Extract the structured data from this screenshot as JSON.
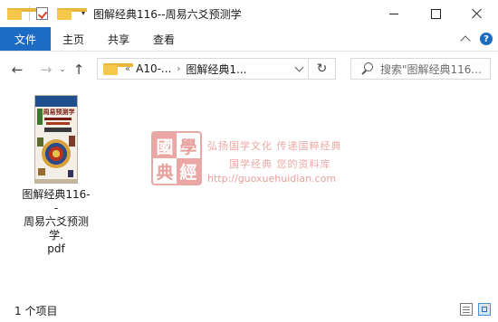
{
  "window": {
    "title": "图解经典116--周易六爻预测学"
  },
  "quick_access": {
    "icons": [
      "folder-icon",
      "properties-check-icon",
      "new-folder-icon",
      "customize-dropdown-icon"
    ]
  },
  "ribbon": {
    "tabs": [
      {
        "label": "文件",
        "active": true
      },
      {
        "label": "主页"
      },
      {
        "label": "共享"
      },
      {
        "label": "查看"
      }
    ],
    "help_label": "?"
  },
  "navigation": {
    "back_icon": "←",
    "forward_icon": "→",
    "recent_icon": "⌄",
    "up_icon": "↑",
    "refresh_icon": "↻"
  },
  "address": {
    "overflow": "«",
    "crumbs": [
      "A10-...",
      "图解经典1..."
    ],
    "separator": "›"
  },
  "search": {
    "placeholder": "搜索\"图解经典116..."
  },
  "files": [
    {
      "name": "图解经典116--周易六爻预测学.pdf",
      "name_lines": [
        "图解经典116--",
        "周易六爻预测学.",
        "pdf"
      ],
      "thumb_title": "周易预测学"
    }
  ],
  "watermark": {
    "seal_chars": [
      "國",
      "學",
      "典",
      "經"
    ],
    "line1": "弘扬国学文化  传递国粹经典",
    "line2": "国学经典  您的资料库",
    "url": "http://guoxuehuidian.com"
  },
  "status": {
    "item_count": "1 个项目"
  },
  "colors": {
    "accent": "#1d6cc4",
    "watermark": "#e8a19d",
    "folder": "#f5c84a"
  }
}
